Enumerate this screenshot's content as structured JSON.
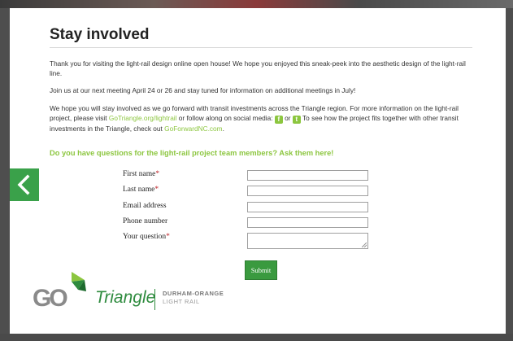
{
  "page": {
    "title": "Stay involved",
    "para1": "Thank you for visiting the light-rail design online open house! We hope you enjoyed this sneak-peek into the aesthetic design of the light-rail line.",
    "para2": "Join us at our next meeting April 24 or 26 and stay tuned for information on additional meetings in July!",
    "para3": {
      "a": "We hope you will stay involved as we go forward with transit investments across the Triangle region. For more information on the light-rail project, please visit ",
      "link1": "GoTriangle.org/lightrail",
      "b": " or follow along on social media: ",
      "or": " or ",
      "c": " To see how the project fits together with other transit investments in the Triangle, check out ",
      "link2": "GoForwardNC.com",
      "d": "."
    },
    "question": "Do you have questions for the light-rail project team members? Ask them here!"
  },
  "social": {
    "facebook_glyph": "f",
    "twitter_glyph": "t",
    "icon_color": "#8cc63f"
  },
  "form": {
    "first_name_label": "First name",
    "last_name_label": "Last name",
    "email_label": "Email address",
    "phone_label": "Phone number",
    "question_label": "Your question",
    "required_mark": "*",
    "first_name_value": "",
    "last_name_value": "",
    "email_value": "",
    "phone_value": "",
    "question_value": "",
    "submit_label": "Submit"
  },
  "nav": {
    "back_icon": "chevron-left-icon"
  },
  "logo": {
    "go_text": "GO",
    "triangle_text": "Triangle",
    "line1": "DURHAM-ORANGE",
    "line2": "LIGHT RAIL"
  },
  "colors": {
    "accent_green": "#8cc63f",
    "button_green": "#3a9a3f",
    "required_red": "#c0272d"
  }
}
